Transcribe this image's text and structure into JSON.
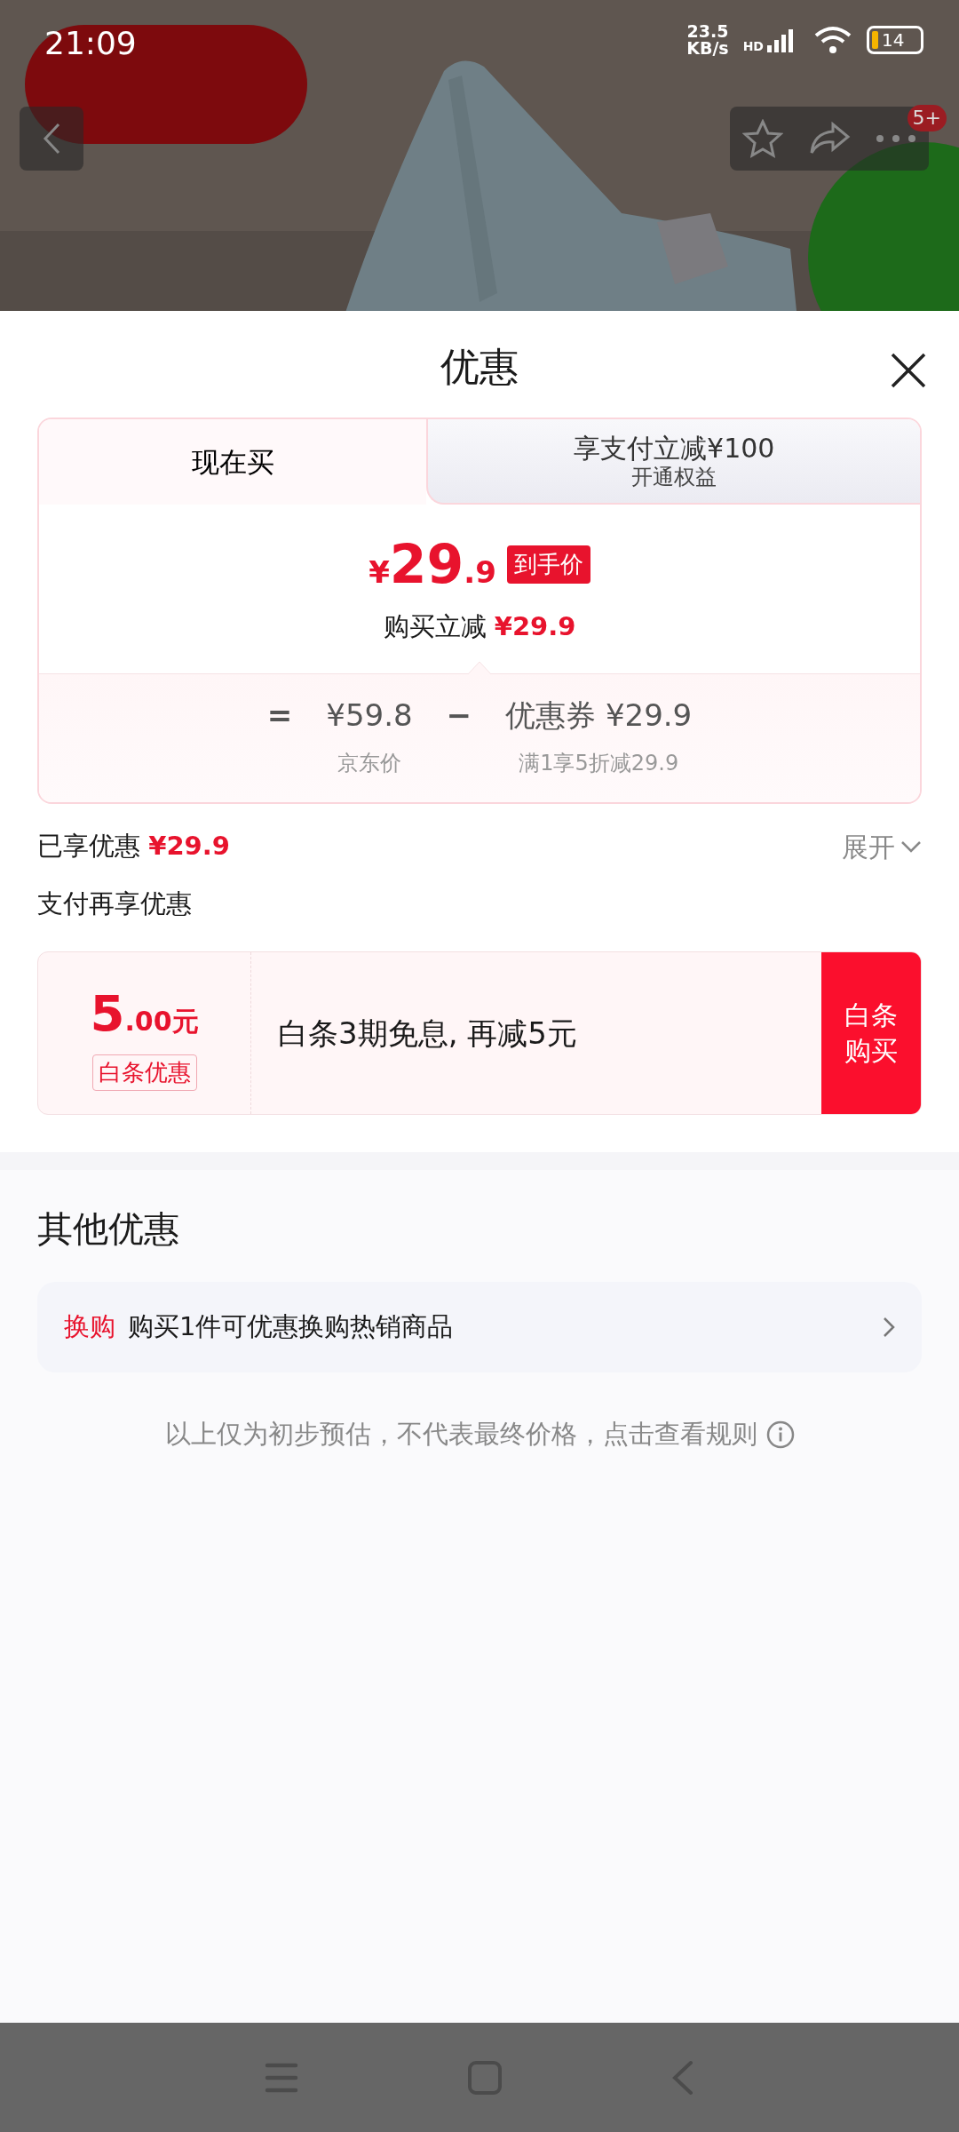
{
  "status_bar": {
    "time": "21:09",
    "speed": "23.5",
    "speed_unit": "KB/s",
    "network": "HD",
    "battery": "14"
  },
  "product_header": {
    "kind": "picture",
    "badge": "5+"
  },
  "sheet": {
    "title": "优惠"
  },
  "tabs": [
    {
      "label": "现在买",
      "selected": true
    },
    {
      "label": "享支付立减¥100",
      "sublabel": "开通权益",
      "selected": false
    }
  ],
  "price": {
    "currency": "¥",
    "integer": "29",
    "decimal": ".9",
    "tag": "到手价",
    "reduction_label": "购买立减",
    "reduction_value": "¥29.9"
  },
  "formula": [
    {
      "sign": "=",
      "value": "¥59.8",
      "label": "京东价"
    },
    {
      "sign": "−",
      "value": "优惠券 ¥29.9",
      "label": "满1享5折减29.9"
    }
  ],
  "enjoyed": {
    "label": "已享优惠",
    "value": "¥29.9",
    "toggle": "展开",
    "expanded": false
  },
  "pay_more": {
    "title": "支付再享优惠",
    "offers": [
      {
        "amount": "5",
        "amount_decimal": ".00",
        "unit": "元",
        "tag": "白条优惠",
        "description": "白条3期免息, 再减5元",
        "button": "白条购买"
      }
    ]
  },
  "other": {
    "title": "其他优惠",
    "items": [
      {
        "tag": "换购",
        "text": "购买1件可优惠换购热销商品"
      }
    ]
  },
  "disclaimer": "以上仅为初步预估，不代表最终价格，点击查看规则"
}
